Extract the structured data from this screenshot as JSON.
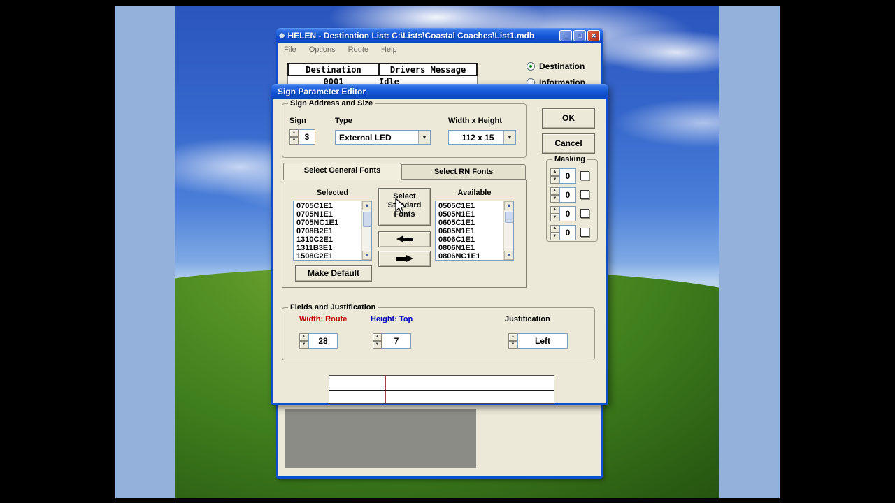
{
  "main_window": {
    "title": "HELEN - Destination List: C:\\Lists\\Coastal Coaches\\List1.mdb",
    "window_buttons": {
      "minimize": "_",
      "maximize": "□",
      "close": "✕"
    },
    "menu": [
      "File",
      "Options",
      "Route",
      "Help"
    ],
    "table": {
      "headers": [
        "Destination",
        "Drivers Message"
      ],
      "rows": [
        {
          "destination": "0001",
          "message": "Idle"
        }
      ]
    },
    "radios": [
      {
        "label": "Destination",
        "selected": true
      },
      {
        "label": "Information",
        "selected": false
      }
    ]
  },
  "dialog": {
    "title": "Sign Parameter Editor",
    "address_group": {
      "label": "Sign Address and Size",
      "sign_label": "Sign",
      "sign_value": "3",
      "type_label": "Type",
      "type_value": "External LED",
      "size_label": "Width x Height",
      "size_value": "112 x 15"
    },
    "ok_label": "OK",
    "cancel_label": "Cancel",
    "masking": {
      "label": "Masking",
      "values": [
        "0",
        "0",
        "0",
        "0"
      ]
    },
    "tabs": [
      {
        "label": "Select General Fonts",
        "active": true
      },
      {
        "label": "Select RN Fonts",
        "active": false
      }
    ],
    "fonts": {
      "selected_label": "Selected",
      "available_label": "Available",
      "selected_items": [
        "0705C1E1",
        "0705N1E1",
        "0705NC1E1",
        "0708B2E1",
        "1310C2E1",
        "1311B3E1",
        "1508C2E1"
      ],
      "available_items": [
        "0505C1E1",
        "0505N1E1",
        "0605C1E1",
        "0605N1E1",
        "0806C1E1",
        "0806N1E1",
        "0806NC1E1"
      ],
      "select_standard_label": "Select Standard Fonts",
      "make_default_label": "Make Default"
    },
    "fields_group": {
      "label": "Fields and Justification",
      "width_label": "Width: Route",
      "width_value": "28",
      "height_label": "Height: Top",
      "height_value": "7",
      "justification_label": "Justification",
      "justification_value": "Left"
    },
    "colors": {
      "width_label": "#c00000",
      "height_label": "#0000c0",
      "titlebar_blue": "#1456d6",
      "dialog_bg": "#ece9d8"
    }
  }
}
